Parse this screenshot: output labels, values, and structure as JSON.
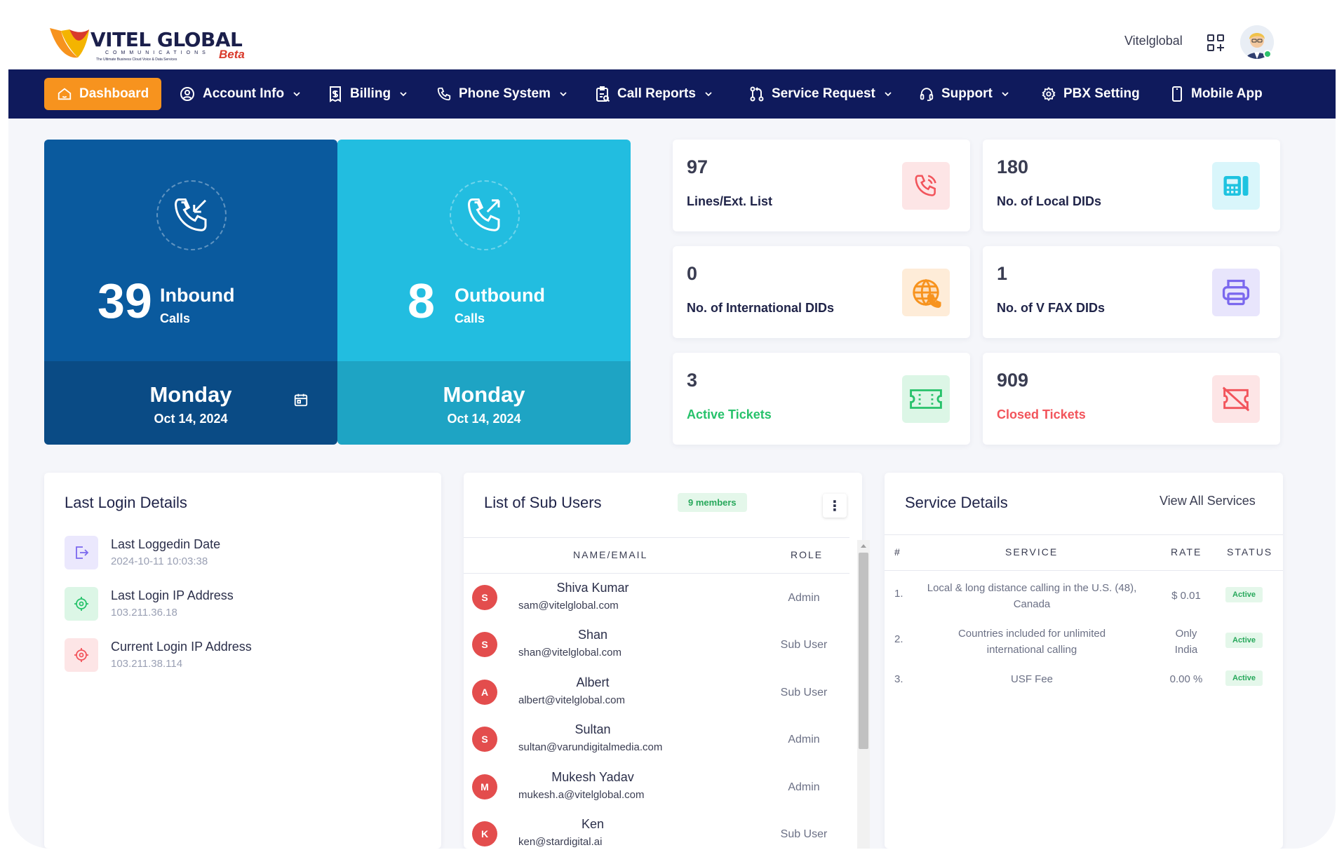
{
  "brand": {
    "name": "VITEL GLOBAL",
    "sub": "COMMUNICATIONS",
    "tagline": "The Ultimate Business Cloud Voice & Data Services",
    "beta": "Beta"
  },
  "header": {
    "user_name": "Vitelglobal"
  },
  "nav": {
    "items": [
      {
        "label": "Dashboard",
        "icon": "home-icon",
        "active": true
      },
      {
        "label": "Account Info",
        "icon": "user-circle-icon"
      },
      {
        "label": "Billing",
        "icon": "receipt-icon"
      },
      {
        "label": "Phone System",
        "icon": "phone-icon"
      },
      {
        "label": "Call Reports",
        "icon": "report-icon"
      },
      {
        "label": "Service Request",
        "icon": "git-pull-icon"
      },
      {
        "label": "Support",
        "icon": "headset-icon"
      },
      {
        "label": "PBX Setting",
        "icon": "gear-icon"
      },
      {
        "label": "Mobile App",
        "icon": "mobile-icon"
      }
    ]
  },
  "inbound": {
    "count": "39",
    "label": "Inbound",
    "sublabel": "Calls",
    "day": "Monday",
    "date": "Oct 14, 2024",
    "color": "#0a5a9e"
  },
  "outbound": {
    "count": "8",
    "label": "Outbound",
    "sublabel": "Calls",
    "day": "Monday",
    "date": "Oct 14, 2024",
    "color": "#22bde0"
  },
  "stats": [
    {
      "value": "97",
      "label": "Lines/Ext. List",
      "icon": "phone-call-icon",
      "accent": "#f2545b"
    },
    {
      "value": "180",
      "label": "No. of Local DIDs",
      "icon": "desk-phone-icon",
      "accent": "#1ec3e0"
    },
    {
      "value": "0",
      "label": "No. of International DIDs",
      "icon": "globe-icon",
      "accent": "#f7931e"
    },
    {
      "value": "1",
      "label": "No. of V FAX DIDs",
      "icon": "printer-icon",
      "accent": "#7b68ee"
    },
    {
      "value": "3",
      "label": "Active Tickets",
      "icon": "ticket-icon",
      "accent": "#27c26b"
    },
    {
      "value": "909",
      "label": "Closed Tickets",
      "icon": "ticket-off-icon",
      "accent": "#f2545b"
    }
  ],
  "last_login": {
    "title": "Last Login Details",
    "rows": [
      {
        "label": "Last Loggedin Date",
        "value": "2024-10-11 10:03:38",
        "icon": "logout-icon"
      },
      {
        "label": "Last Login IP Address",
        "value": "103.211.36.18",
        "icon": "target-icon"
      },
      {
        "label": "Current Login IP Address",
        "value": "103.211.38.114",
        "icon": "target-icon"
      }
    ]
  },
  "sub_users": {
    "title": "List of Sub Users",
    "badge": "9 members",
    "col_name": "NAME/EMAIL",
    "col_role": "ROLE",
    "rows": [
      {
        "initial": "S",
        "name": "Shiva Kumar",
        "email": "sam@vitelglobal.com",
        "role": "Admin"
      },
      {
        "initial": "S",
        "name": "Shan",
        "email": "shan@vitelglobal.com",
        "role": "Sub User"
      },
      {
        "initial": "A",
        "name": "Albert",
        "email": "albert@vitelglobal.com",
        "role": "Sub User"
      },
      {
        "initial": "S",
        "name": "Sultan",
        "email": "sultan@varundigitalmedia.com",
        "role": "Admin"
      },
      {
        "initial": "M",
        "name": "Mukesh Yadav",
        "email": "mukesh.a@vitelglobal.com",
        "role": "Admin"
      },
      {
        "initial": "K",
        "name": "Ken",
        "email": "ken@stardigital.ai",
        "role": "Sub User"
      }
    ]
  },
  "services": {
    "title": "Service Details",
    "view_all": "View All Services",
    "cols": {
      "no": "#",
      "service": "SERVICE",
      "rate": "RATE",
      "status": "STATUS"
    },
    "rows": [
      {
        "no": "1.",
        "service": "Local & long distance calling in the U.S. (48), Canada",
        "rate": "$ 0.01",
        "status": "Active"
      },
      {
        "no": "2.",
        "service": "Countries included for unlimited international calling",
        "rate": "Only India",
        "status": "Active"
      },
      {
        "no": "3.",
        "service": "USF Fee",
        "rate": "0.00 %",
        "status": "Active"
      }
    ]
  }
}
